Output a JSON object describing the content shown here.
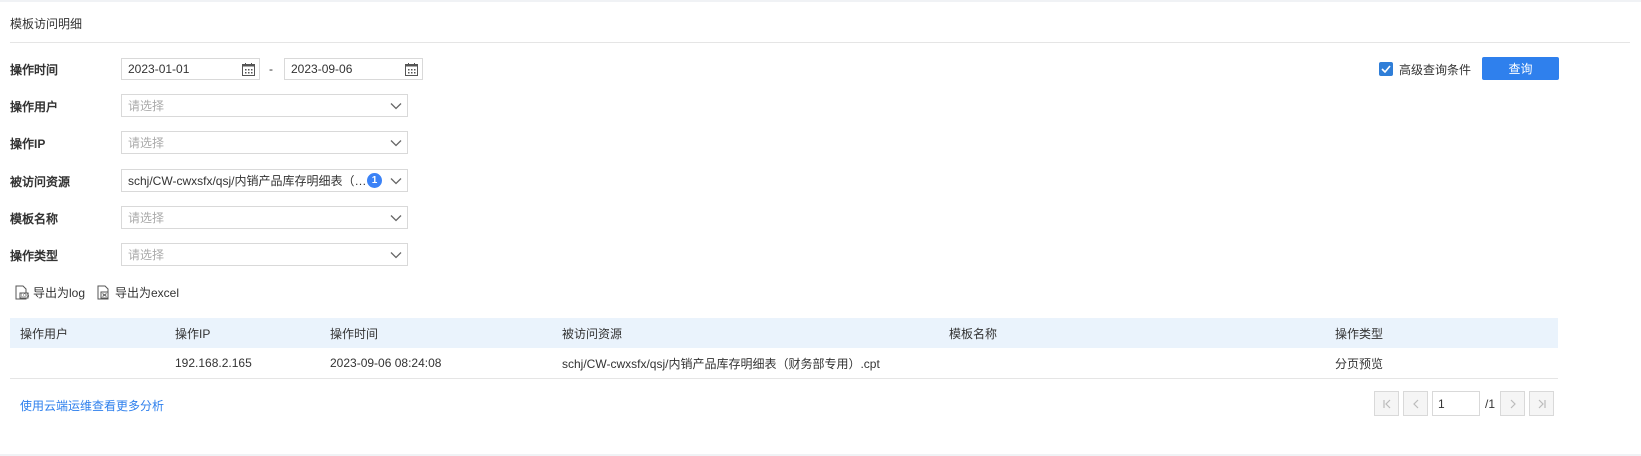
{
  "panel": {
    "title": "模板访问明细"
  },
  "form": {
    "time": {
      "label": "操作时间",
      "start": "2023-01-01",
      "end": "2023-09-06",
      "separator": "-"
    },
    "user": {
      "label": "操作用户",
      "placeholder": "请选择"
    },
    "ip": {
      "label": "操作IP",
      "placeholder": "请选择"
    },
    "resource": {
      "label": "被访问资源",
      "value": "schj/CW-cwxsfx/qsj/内销产品库存明细表（财务部专用）.cpt",
      "count": "1"
    },
    "template": {
      "label": "模板名称",
      "placeholder": "请选择"
    },
    "optype": {
      "label": "操作类型",
      "placeholder": "请选择"
    }
  },
  "advanced": {
    "label": "高级查询条件",
    "checked": true
  },
  "query_button": "查询",
  "export": {
    "log": "导出为log",
    "excel": "导出为excel"
  },
  "table": {
    "columns": [
      "操作用户",
      "操作IP",
      "操作时间",
      "被访问资源",
      "模板名称",
      "操作类型"
    ],
    "rows": [
      [
        "",
        "192.168.2.165",
        "2023-09-06 08:24:08",
        "schj/CW-cwxsfx/qsj/内销产品库存明细表（财务部专用）.cpt",
        "",
        "分页预览"
      ]
    ]
  },
  "footer": {
    "more_link": "使用云端运维查看更多分析"
  },
  "pagination": {
    "current": "1",
    "total": "/1"
  },
  "colors": {
    "accent": "#2f80ed",
    "header_bg": "#eaf3fc"
  }
}
